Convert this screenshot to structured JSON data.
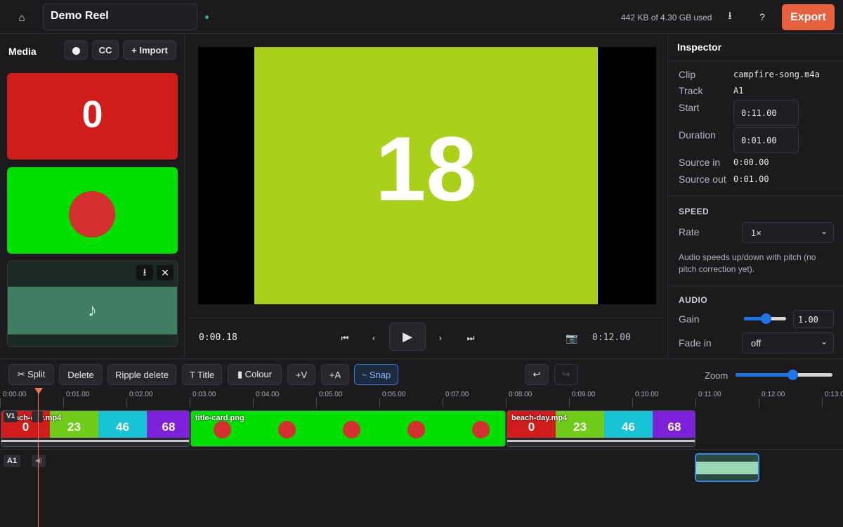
{
  "header": {
    "home_icon": "home-icon",
    "project_name": "Demo Reel",
    "storage": "442 KB of 4.30 GB used",
    "download_icon": "⭳",
    "help_label": "?",
    "export_label": "Export",
    "export_color": "#e8613f"
  },
  "media": {
    "title": "Media",
    "cc_label": "CC",
    "import_label": "+ Import",
    "items": [
      {
        "label": "0",
        "color": "#d21b1b"
      },
      {
        "label": "",
        "color": "#00e000"
      },
      {
        "label": "♪",
        "color": "#3f7e62"
      }
    ],
    "download_icon": "⭳",
    "remove_icon": "✕"
  },
  "preview": {
    "frame_number": "18",
    "frame_color": "#abd01a",
    "current_time": "0:00.18",
    "total_time": "0:12.00"
  },
  "inspector": {
    "title": "Inspector",
    "clip_label": "Clip",
    "clip_value": "campfire-song.m4a",
    "track_label": "Track",
    "track_value": "A1",
    "start_label": "Start",
    "start_value": "0:11.00",
    "duration_label": "Duration",
    "duration_value": "0:01.00",
    "source_in_label": "Source in",
    "source_in_value": "0:00.00",
    "source_out_label": "Source out",
    "source_out_value": "0:01.00",
    "speed_heading": "SPEED",
    "rate_label": "Rate",
    "rate_value": "1×",
    "speed_note": "Audio speeds up/down with pitch (no pitch correction yet).",
    "audio_heading": "AUDIO",
    "gain_label": "Gain",
    "gain_value": "1.00",
    "fade_in_label": "Fade in",
    "fade_in_value": "off"
  },
  "toolbar": {
    "split_label": "✂ Split",
    "delete_label": "Delete",
    "ripple_label": "Ripple delete",
    "title_label": "T Title",
    "colour_label": "▮ Colour",
    "add_video_label": "+V",
    "add_audio_label": "+A",
    "snap_label": "~ Snap",
    "undo_icon": "↩",
    "redo_icon": "↪",
    "zoom_label": "Zoom"
  },
  "timeline": {
    "ruler": [
      "0:00.00",
      "0:01.00",
      "0:02.00",
      "0:03.00",
      "0:04.00",
      "0:05.00",
      "0:06.00",
      "0:07.00",
      "0:08.00",
      "0:09.00",
      "0:10.00",
      "0:11.00",
      "0:12.00",
      "0:13.0"
    ],
    "v1_label": "V1",
    "a1_label": "A1",
    "clips": [
      {
        "name": "beach-day.mp4",
        "segments": [
          "0",
          "23",
          "46",
          "68"
        ]
      },
      {
        "name": "title-card.png",
        "segments": []
      },
      {
        "name": "beach-day.mp4",
        "segments": [
          "0",
          "23",
          "46",
          "68"
        ]
      }
    ],
    "segment_colors": [
      "#d21b1b",
      "#6fcc1a",
      "#18c4d4",
      "#7d20d9"
    ]
  }
}
